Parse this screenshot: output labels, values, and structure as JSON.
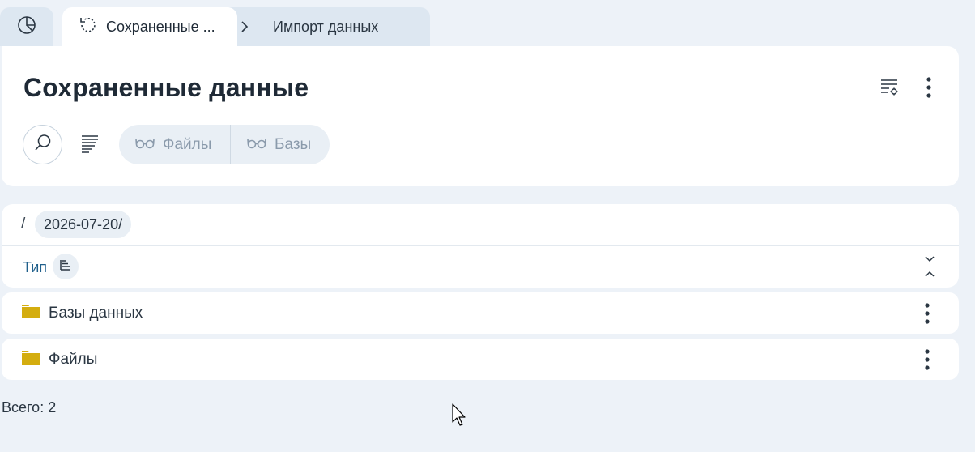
{
  "tabs": {
    "home_icon": "pie-chart-icon",
    "active_label": "Сохраненные ...",
    "active_icon": "history-icon",
    "next_label": "Импорт данных"
  },
  "header": {
    "title": "Сохраненные данные",
    "filters": [
      {
        "label": "Файлы",
        "icon": "glasses-icon"
      },
      {
        "label": "Базы",
        "icon": "glasses-icon"
      }
    ]
  },
  "breadcrumb": {
    "root": "/",
    "current": "2026-07-20/"
  },
  "table": {
    "column_type": "Тип",
    "rows": [
      {
        "label": "Базы данных",
        "icon": "folder-icon"
      },
      {
        "label": "Файлы",
        "icon": "folder-icon"
      }
    ]
  },
  "footer": {
    "total": "Всего: 2"
  },
  "colors": {
    "background": "#edf2f8",
    "card": "#ffffff",
    "folder": "#d4ad0f",
    "link": "#1f5f8b"
  }
}
